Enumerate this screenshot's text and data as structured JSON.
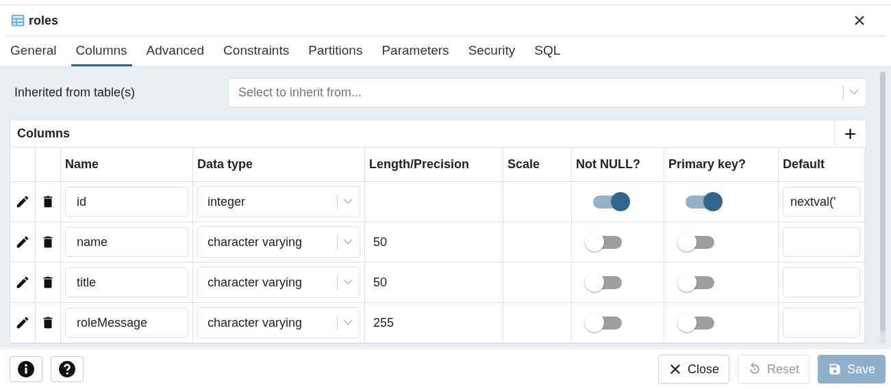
{
  "window": {
    "title": "roles"
  },
  "tabs": [
    {
      "label": "General",
      "selected": false
    },
    {
      "label": "Columns",
      "selected": true
    },
    {
      "label": "Advanced",
      "selected": false
    },
    {
      "label": "Constraints",
      "selected": false
    },
    {
      "label": "Partitions",
      "selected": false
    },
    {
      "label": "Parameters",
      "selected": false
    },
    {
      "label": "Security",
      "selected": false
    },
    {
      "label": "SQL",
      "selected": false
    }
  ],
  "inherit": {
    "label": "Inherited from table(s)",
    "placeholder": "Select to inherit from..."
  },
  "columns_table": {
    "title": "Columns",
    "add_button": "+",
    "headers": [
      "Name",
      "Data type",
      "Length/Precision",
      "Scale",
      "Not NULL?",
      "Primary key?",
      "Default"
    ],
    "rows": [
      {
        "name": "id",
        "data_type": "integer",
        "length": "",
        "not_null": true,
        "primary_key": true,
        "default": "nextval('"
      },
      {
        "name": "name",
        "data_type": "character varying",
        "length": "50",
        "not_null": false,
        "primary_key": false,
        "default": ""
      },
      {
        "name": "title",
        "data_type": "character varying",
        "length": "50",
        "not_null": false,
        "primary_key": false,
        "default": ""
      },
      {
        "name": "roleMessage",
        "data_type": "character varying",
        "length": "255",
        "not_null": false,
        "primary_key": false,
        "default": ""
      }
    ]
  },
  "footer": {
    "buttons": [
      {
        "label": "Close",
        "kind": "close",
        "disabled": false
      },
      {
        "label": "Reset",
        "kind": "reset",
        "disabled": true
      },
      {
        "label": "Save",
        "kind": "save",
        "disabled": true
      }
    ]
  }
}
